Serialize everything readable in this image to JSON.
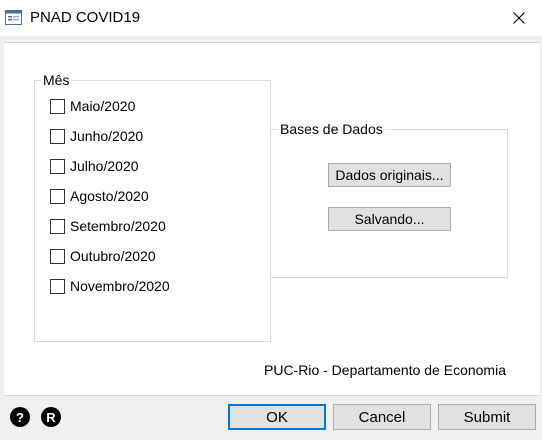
{
  "window": {
    "title": "PNAD COVID19",
    "icons": {
      "app": "window-dialog-icon",
      "close": "close-icon"
    }
  },
  "month_group": {
    "legend": "Mês",
    "items": [
      {
        "label": "Maio/2020",
        "checked": false
      },
      {
        "label": "Junho/2020",
        "checked": false
      },
      {
        "label": "Julho/2020",
        "checked": false
      },
      {
        "label": "Agosto/2020",
        "checked": false
      },
      {
        "label": "Setembro/2020",
        "checked": false
      },
      {
        "label": "Outubro/2020",
        "checked": false
      },
      {
        "label": "Novembro/2020",
        "checked": false
      }
    ]
  },
  "bases_group": {
    "legend": "Bases de Dados",
    "original_button": "Dados originais...",
    "saving_button": "Salvando..."
  },
  "credit": "PUC-Rio - Departamento de Economia",
  "footer": {
    "help_icon": {
      "name": "help-icon",
      "glyph": "?"
    },
    "r_icon": {
      "name": "r-icon",
      "glyph": "R"
    },
    "ok": "OK",
    "cancel": "Cancel",
    "submit": "Submit"
  },
  "colors": {
    "dialog_bg": "#f0f0f0",
    "button_bg": "#e1e1e1",
    "default_button_border": "#0078d7"
  }
}
